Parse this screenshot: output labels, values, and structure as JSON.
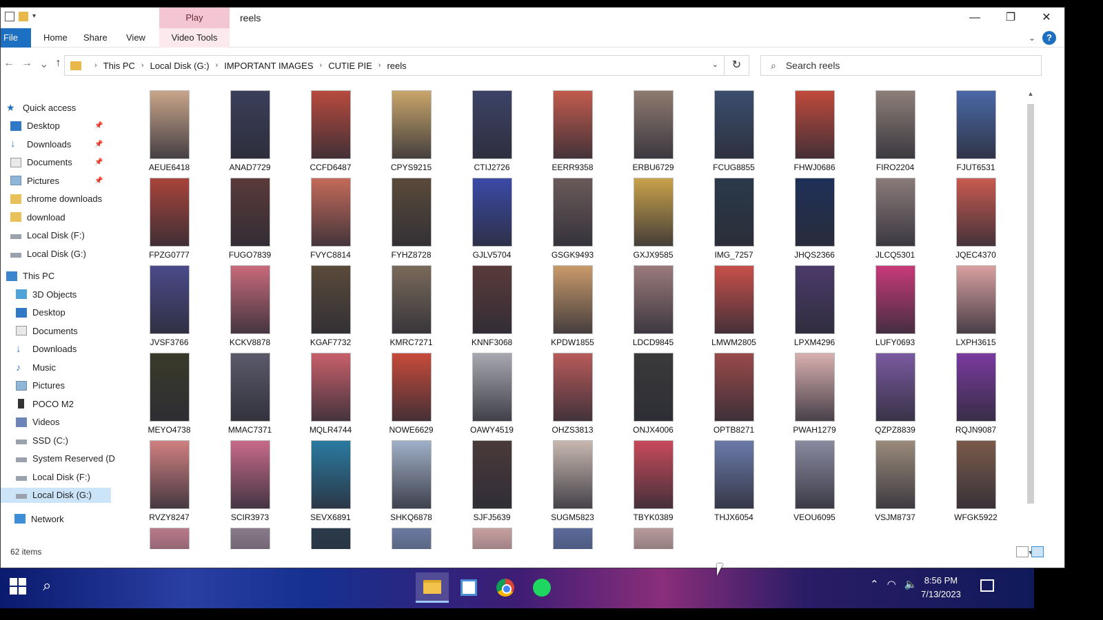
{
  "window": {
    "title": "reels",
    "context_tab": "Play",
    "controls": {
      "minimize": "—",
      "restore": "❐",
      "close": "✕"
    }
  },
  "ribbon": {
    "tabs": [
      "File",
      "Home",
      "Share",
      "View",
      "Video Tools"
    ],
    "help": "?"
  },
  "address": {
    "breadcrumbs": [
      "This PC",
      "Local Disk (G:)",
      "IMPORTANT IMAGES",
      "CUTIE PIE",
      "reels"
    ]
  },
  "search": {
    "placeholder": "Search reels"
  },
  "nav": {
    "quick_access": "Quick access",
    "quick_items": [
      {
        "label": "Desktop",
        "pinned": true
      },
      {
        "label": "Downloads",
        "pinned": true
      },
      {
        "label": "Documents",
        "pinned": true
      },
      {
        "label": "Pictures",
        "pinned": true
      },
      {
        "label": "chrome downloads",
        "pinned": false
      },
      {
        "label": "download",
        "pinned": false
      },
      {
        "label": "Local Disk (F:)",
        "pinned": false
      },
      {
        "label": "Local Disk (G:)",
        "pinned": false
      }
    ],
    "this_pc": "This PC",
    "pc_items": [
      "3D Objects",
      "Desktop",
      "Documents",
      "Downloads",
      "Music",
      "Pictures",
      "POCO M2",
      "Videos",
      "SSD (C:)",
      "System Reserved (D",
      "Local Disk (F:)",
      "Local Disk (G:)"
    ],
    "selected": "Local Disk (G:)",
    "network": "Network"
  },
  "files": [
    "AEUE6418",
    "ANAD7729",
    "CCFD6487",
    "CPYS9215",
    "CTIJ2726",
    "EERR9358",
    "ERBU6729",
    "FCUG8855",
    "FHWJ0686",
    "FIRO2204",
    "FJUT6531",
    "FPZG0777",
    "FUGO7839",
    "FVYC8814",
    "FYHZ8728",
    "GJLV5704",
    "GSGK9493",
    "GXJX9585",
    "IMG_7257",
    "JHQS2366",
    "JLCQ5301",
    "JQEC4370",
    "JVSF3766",
    "KCKV8878",
    "KGAF7732",
    "KMRC7271",
    "KNNF3068",
    "KPDW1855",
    "LDCD9845",
    "LMWM2805",
    "LPXM4296",
    "LUFY0693",
    "LXPH3615",
    "MEYO4738",
    "MMAC7371",
    "MQLR4744",
    "NOWE6629",
    "OAWY4519",
    "OHZS3813",
    "ONJX4006",
    "OPTB8271",
    "PWAH1279",
    "QZPZ8839",
    "RQJN9087",
    "RVZY8247",
    "SCIR3973",
    "SEVX6891",
    "SHKQ6878",
    "SJFJ5639",
    "SUGM5823",
    "TBYK0389",
    "THJX6054",
    "VEOU6095",
    "VSJM8737",
    "WFGK5922"
  ],
  "thumb_colors": [
    "#c9a58a",
    "#3a3f5a",
    "#b84a3e",
    "#c9a66a",
    "#3c4366",
    "#c25b4d",
    "#8e7a70",
    "#3b4e6e",
    "#c04a3c",
    "#8d7f78",
    "#4a68a6",
    "#a8443a",
    "#5a3a38",
    "#c46a5a",
    "#5a4a3a",
    "#3a4aa6",
    "#6a5a5a",
    "#c9a24a",
    "#2a3a4a",
    "#1e3058",
    "#8a7a7a",
    "#c85a50",
    "#4a4a8a",
    "#c86a7a",
    "#5a4a3a",
    "#7a6a5a",
    "#5a3a3a",
    "#c99a6a",
    "#9a7a7a",
    "#c8504a",
    "#4a3a6a",
    "#c83a7a",
    "#d9a0a0",
    "#3a3a2a",
    "#5a5a6a",
    "#c8606a",
    "#c84a3a",
    "#a8a8b0",
    "#b85a5a",
    "#3a3a3a",
    "#9a4a4a",
    "#d9b0b0",
    "#7a5aa0",
    "#7a3aa0",
    "#d08080",
    "#c86a8a",
    "#2a7aa0",
    "#a0b0c8",
    "#4a3a3a",
    "#c8b8b0",
    "#c84a5a",
    "#6a7aa8",
    "#8a8aa0",
    "#9a8a7a",
    "#7a5a4a",
    "#b87a8a",
    "#8a7a8a",
    "#2a3a4a",
    "#6a7aa0",
    "#c8a0a0",
    "#5a6a9a",
    "#b89a9a"
  ],
  "partial_row_count": 7,
  "status": {
    "count": "62 items"
  },
  "taskbar": {
    "apps": [
      "file-explorer",
      "microsoft-store",
      "chrome",
      "spotify"
    ],
    "time": "8:56 PM",
    "date": "7/13/2023"
  }
}
